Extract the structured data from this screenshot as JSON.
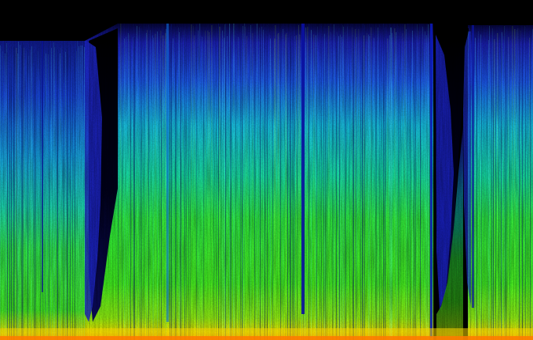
{
  "image": {
    "kind": "spectrogram",
    "colors": {
      "background": "#000000",
      "low": "#0a0a6e",
      "mid_low": "#1e3cff",
      "mid": "#13d6d6",
      "mid_high": "#2cf01a",
      "high": "#b8f000",
      "peak": "#ffd000",
      "max": "#ff6a00"
    }
  }
}
